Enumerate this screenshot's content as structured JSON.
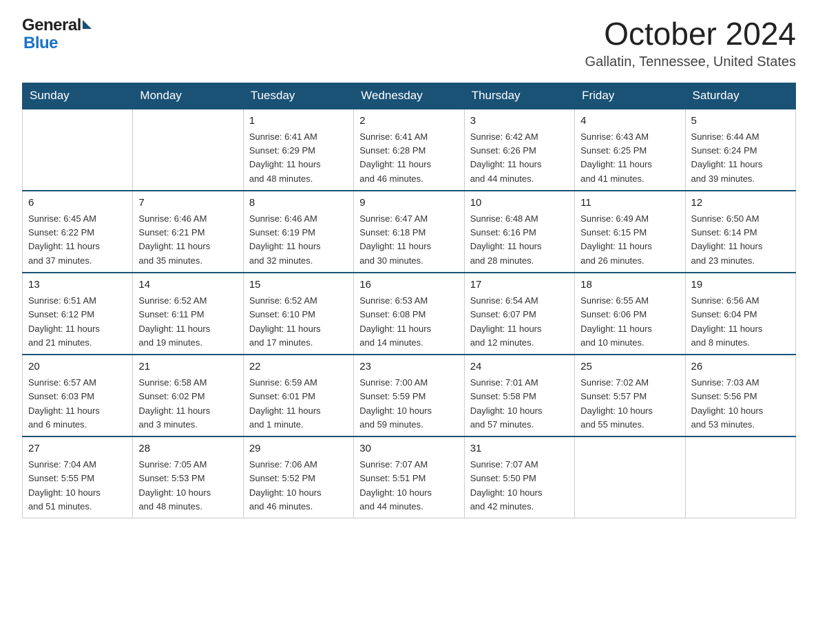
{
  "header": {
    "title": "October 2024",
    "subtitle": "Gallatin, Tennessee, United States",
    "logo_general": "General",
    "logo_blue": "Blue"
  },
  "days_of_week": [
    "Sunday",
    "Monday",
    "Tuesday",
    "Wednesday",
    "Thursday",
    "Friday",
    "Saturday"
  ],
  "weeks": [
    [
      {
        "day": "",
        "info": ""
      },
      {
        "day": "",
        "info": ""
      },
      {
        "day": "1",
        "info": "Sunrise: 6:41 AM\nSunset: 6:29 PM\nDaylight: 11 hours\nand 48 minutes."
      },
      {
        "day": "2",
        "info": "Sunrise: 6:41 AM\nSunset: 6:28 PM\nDaylight: 11 hours\nand 46 minutes."
      },
      {
        "day": "3",
        "info": "Sunrise: 6:42 AM\nSunset: 6:26 PM\nDaylight: 11 hours\nand 44 minutes."
      },
      {
        "day": "4",
        "info": "Sunrise: 6:43 AM\nSunset: 6:25 PM\nDaylight: 11 hours\nand 41 minutes."
      },
      {
        "day": "5",
        "info": "Sunrise: 6:44 AM\nSunset: 6:24 PM\nDaylight: 11 hours\nand 39 minutes."
      }
    ],
    [
      {
        "day": "6",
        "info": "Sunrise: 6:45 AM\nSunset: 6:22 PM\nDaylight: 11 hours\nand 37 minutes."
      },
      {
        "day": "7",
        "info": "Sunrise: 6:46 AM\nSunset: 6:21 PM\nDaylight: 11 hours\nand 35 minutes."
      },
      {
        "day": "8",
        "info": "Sunrise: 6:46 AM\nSunset: 6:19 PM\nDaylight: 11 hours\nand 32 minutes."
      },
      {
        "day": "9",
        "info": "Sunrise: 6:47 AM\nSunset: 6:18 PM\nDaylight: 11 hours\nand 30 minutes."
      },
      {
        "day": "10",
        "info": "Sunrise: 6:48 AM\nSunset: 6:16 PM\nDaylight: 11 hours\nand 28 minutes."
      },
      {
        "day": "11",
        "info": "Sunrise: 6:49 AM\nSunset: 6:15 PM\nDaylight: 11 hours\nand 26 minutes."
      },
      {
        "day": "12",
        "info": "Sunrise: 6:50 AM\nSunset: 6:14 PM\nDaylight: 11 hours\nand 23 minutes."
      }
    ],
    [
      {
        "day": "13",
        "info": "Sunrise: 6:51 AM\nSunset: 6:12 PM\nDaylight: 11 hours\nand 21 minutes."
      },
      {
        "day": "14",
        "info": "Sunrise: 6:52 AM\nSunset: 6:11 PM\nDaylight: 11 hours\nand 19 minutes."
      },
      {
        "day": "15",
        "info": "Sunrise: 6:52 AM\nSunset: 6:10 PM\nDaylight: 11 hours\nand 17 minutes."
      },
      {
        "day": "16",
        "info": "Sunrise: 6:53 AM\nSunset: 6:08 PM\nDaylight: 11 hours\nand 14 minutes."
      },
      {
        "day": "17",
        "info": "Sunrise: 6:54 AM\nSunset: 6:07 PM\nDaylight: 11 hours\nand 12 minutes."
      },
      {
        "day": "18",
        "info": "Sunrise: 6:55 AM\nSunset: 6:06 PM\nDaylight: 11 hours\nand 10 minutes."
      },
      {
        "day": "19",
        "info": "Sunrise: 6:56 AM\nSunset: 6:04 PM\nDaylight: 11 hours\nand 8 minutes."
      }
    ],
    [
      {
        "day": "20",
        "info": "Sunrise: 6:57 AM\nSunset: 6:03 PM\nDaylight: 11 hours\nand 6 minutes."
      },
      {
        "day": "21",
        "info": "Sunrise: 6:58 AM\nSunset: 6:02 PM\nDaylight: 11 hours\nand 3 minutes."
      },
      {
        "day": "22",
        "info": "Sunrise: 6:59 AM\nSunset: 6:01 PM\nDaylight: 11 hours\nand 1 minute."
      },
      {
        "day": "23",
        "info": "Sunrise: 7:00 AM\nSunset: 5:59 PM\nDaylight: 10 hours\nand 59 minutes."
      },
      {
        "day": "24",
        "info": "Sunrise: 7:01 AM\nSunset: 5:58 PM\nDaylight: 10 hours\nand 57 minutes."
      },
      {
        "day": "25",
        "info": "Sunrise: 7:02 AM\nSunset: 5:57 PM\nDaylight: 10 hours\nand 55 minutes."
      },
      {
        "day": "26",
        "info": "Sunrise: 7:03 AM\nSunset: 5:56 PM\nDaylight: 10 hours\nand 53 minutes."
      }
    ],
    [
      {
        "day": "27",
        "info": "Sunrise: 7:04 AM\nSunset: 5:55 PM\nDaylight: 10 hours\nand 51 minutes."
      },
      {
        "day": "28",
        "info": "Sunrise: 7:05 AM\nSunset: 5:53 PM\nDaylight: 10 hours\nand 48 minutes."
      },
      {
        "day": "29",
        "info": "Sunrise: 7:06 AM\nSunset: 5:52 PM\nDaylight: 10 hours\nand 46 minutes."
      },
      {
        "day": "30",
        "info": "Sunrise: 7:07 AM\nSunset: 5:51 PM\nDaylight: 10 hours\nand 44 minutes."
      },
      {
        "day": "31",
        "info": "Sunrise: 7:07 AM\nSunset: 5:50 PM\nDaylight: 10 hours\nand 42 minutes."
      },
      {
        "day": "",
        "info": ""
      },
      {
        "day": "",
        "info": ""
      }
    ]
  ]
}
